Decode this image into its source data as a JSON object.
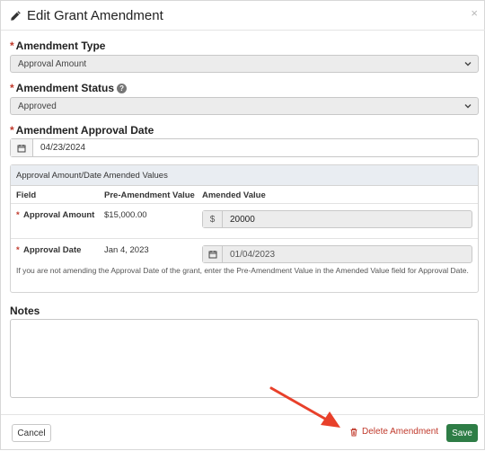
{
  "header": {
    "title": "Edit Grant Amendment",
    "close_symbol": "×"
  },
  "amendment_type": {
    "required_mark": "*",
    "label": "Amendment Type",
    "value": "Approval Amount"
  },
  "amendment_status": {
    "required_mark": "*",
    "label": "Amendment Status",
    "help_symbol": "?",
    "value": "Approved"
  },
  "approval_date": {
    "required_mark": "*",
    "label": "Amendment Approval Date",
    "value": "04/23/2024"
  },
  "panel": {
    "heading": "Approval Amount/Date Amended Values",
    "columns": [
      "Field",
      "Pre-Amendment Value",
      "Amended Value"
    ],
    "rows": [
      {
        "required_mark": "*",
        "field": "Approval Amount",
        "pre_value": "$15,000.00",
        "addon": "$",
        "amended_value": "20000"
      },
      {
        "required_mark": "*",
        "field": "Approval Date",
        "pre_value": "Jan 4, 2023",
        "amended_value": "01/04/2023"
      }
    ],
    "note": "If you are not amending the Approval Date of the grant, enter the Pre-Amendment Value in the Amended Value field for Approval Date."
  },
  "notes": {
    "label": "Notes",
    "value": ""
  },
  "footer": {
    "cancel_label": "Cancel",
    "delete_label": "Delete Amendment",
    "save_label": "Save"
  },
  "colors": {
    "required": "#c0392b",
    "delete": "#c0392b",
    "save_bg": "#2e7d46",
    "arrow": "#e8402a"
  },
  "icons": [
    "pencil-icon",
    "close-icon",
    "help-icon",
    "chevron-down-icon",
    "calendar-icon",
    "trash-icon",
    "annotation-arrow"
  ]
}
